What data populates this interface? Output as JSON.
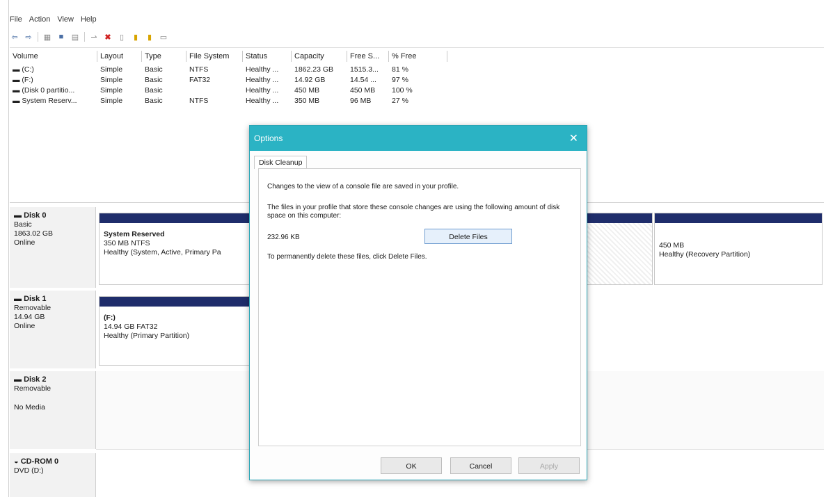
{
  "menu": [
    "File",
    "Action",
    "View",
    "Help"
  ],
  "toolbar": {
    "icons": [
      {
        "name": "back-arrow-icon",
        "glyph": "⇦"
      },
      {
        "name": "forward-arrow-icon",
        "glyph": "⇨"
      },
      {
        "name": "console-tree-icon",
        "glyph": "▦"
      },
      {
        "name": "help-icon",
        "glyph": "■"
      },
      {
        "name": "properties-icon",
        "glyph": "▤"
      },
      {
        "name": "connect-icon",
        "glyph": "⇀"
      },
      {
        "name": "delete-icon",
        "glyph": "✖"
      },
      {
        "name": "new-document-icon",
        "glyph": "▯"
      },
      {
        "name": "folder-icon",
        "glyph": "▮"
      },
      {
        "name": "search-folder-icon",
        "glyph": "▮"
      },
      {
        "name": "window-icon",
        "glyph": "▭"
      }
    ]
  },
  "list": {
    "columns": [
      "Volume",
      "Layout",
      "Type",
      "File System",
      "Status",
      "Capacity",
      "Free S...",
      "% Free"
    ],
    "rows": [
      [
        "(C:)",
        "Simple",
        "Basic",
        "NTFS",
        "Healthy ...",
        "1862.23 GB",
        "1515.3...",
        "81 %"
      ],
      [
        "(F:)",
        "Simple",
        "Basic",
        "FAT32",
        "Healthy ...",
        "14.92 GB",
        "14.54 ...",
        "97 %"
      ],
      [
        "(Disk 0 partitio...",
        "Simple",
        "Basic",
        "",
        "Healthy ...",
        "450 MB",
        "450 MB",
        "100 %"
      ],
      [
        "System Reserv...",
        "Simple",
        "Basic",
        "NTFS",
        "Healthy ...",
        "350 MB",
        "96 MB",
        "27 %"
      ]
    ]
  },
  "disks": [
    {
      "name": "Disk 0",
      "type": "Basic",
      "size": "1863.02 GB",
      "status": "Online"
    },
    {
      "name": "Disk 1",
      "type": "Removable",
      "size": "14.94 GB",
      "status": "Online"
    },
    {
      "name": "Disk 2",
      "type": "Removable",
      "size": "",
      "status": "No Media"
    },
    {
      "name": "CD-ROM 0",
      "type": "DVD (D:)",
      "size": "",
      "status": ""
    }
  ],
  "partitions": {
    "d0p1": {
      "title": "System Reserved",
      "line2": "350 MB NTFS",
      "line3": "Healthy (System, Active, Primary Pa"
    },
    "d0p3": {
      "line2": "450 MB",
      "line3": "Healthy (Recovery Partition)"
    },
    "d1p1": {
      "title": "(F:)",
      "line2": "14.94 GB FAT32",
      "line3": "Healthy (Primary Partition)"
    }
  },
  "dialog": {
    "title": "Options",
    "close": "✕",
    "tab": "Disk Cleanup",
    "line1": "Changes to the view of a console file are saved in your profile.",
    "line2": "The files in your profile that store these console changes are using the following amount of disk space on this computer:",
    "size": "232.96 KB",
    "delete_label": "Delete Files",
    "line3": "To permanently delete these files, click Delete Files.",
    "ok": "OK",
    "cancel": "Cancel",
    "apply": "Apply"
  }
}
